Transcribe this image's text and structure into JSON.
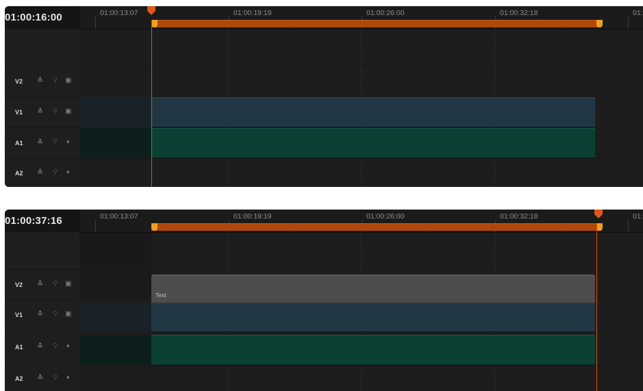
{
  "panels": [
    {
      "timecode": "01:00:16:00",
      "ruler_labels": [
        "01:00:13:07",
        "01:00:19:19",
        "01:00:26:00",
        "01:00:32:18",
        "01:"
      ],
      "tracks": [
        {
          "name": "V2",
          "type": "video",
          "auto_icon": "sync-icon",
          "lock_icon": "lock-icon",
          "mon_icon": "monitor-icon"
        },
        {
          "name": "V1",
          "type": "video",
          "auto_icon": "sync-icon",
          "lock_icon": "lock-icon",
          "mon_icon": "monitor-icon"
        },
        {
          "name": "A1",
          "type": "audio",
          "auto_icon": "sync-icon",
          "lock_icon": "lock-icon",
          "mon_icon": "speaker-icon"
        },
        {
          "name": "A2",
          "type": "audio",
          "auto_icon": "sync-icon",
          "lock_icon": "lock-icon",
          "mon_icon": "speaker-icon"
        }
      ]
    },
    {
      "timecode": "01:00:37:16",
      "ruler_labels": [
        "01:00:13:07",
        "01:00:19:19",
        "01:00:26:00",
        "01:00:32:18",
        "01:"
      ],
      "tracks": [
        {
          "name": "V2",
          "type": "video",
          "auto_icon": "sync-icon",
          "lock_icon": "lock-icon",
          "mon_icon": "monitor-icon"
        },
        {
          "name": "V1",
          "type": "video",
          "auto_icon": "sync-icon",
          "lock_icon": "lock-icon",
          "mon_icon": "monitor-icon"
        },
        {
          "name": "A1",
          "type": "audio",
          "auto_icon": "sync-icon",
          "lock_icon": "lock-icon",
          "mon_icon": "speaker-icon"
        },
        {
          "name": "A2",
          "type": "audio",
          "auto_icon": "sync-icon",
          "lock_icon": "lock-icon",
          "mon_icon": "speaker-icon"
        }
      ],
      "text_clip_label": "Text"
    }
  ],
  "colors": {
    "playhead": "#e0561c",
    "inout_range": "#b0470b",
    "marker": "#f0a020",
    "video_clip": "#213743",
    "audio_clip": "#0b4034",
    "text_clip": "#4d4d4d"
  }
}
